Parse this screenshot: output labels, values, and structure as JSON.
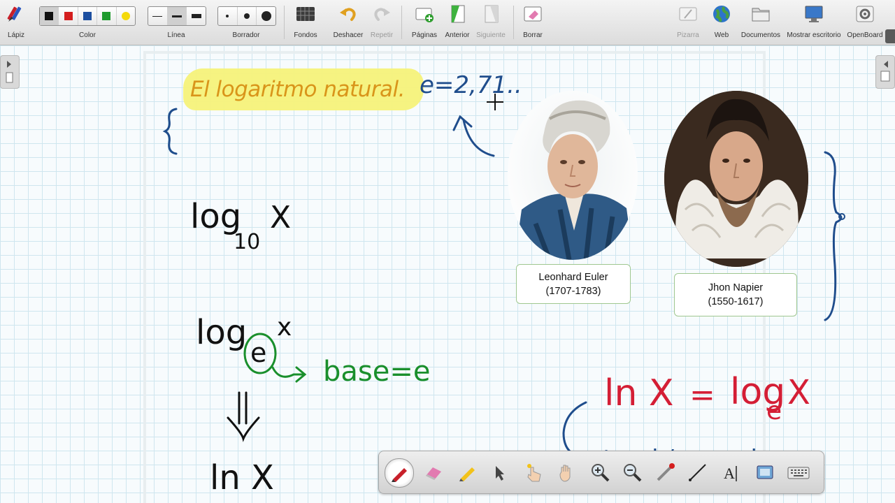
{
  "toolbar": {
    "pencil_label": "Lápiz",
    "color_label": "Color",
    "colors": [
      "#111111",
      "#d41e1e",
      "#1d4fa0",
      "#1f9a2e",
      "#f4d90a"
    ],
    "line_label": "Línea",
    "eraser_label": "Borrador",
    "backgrounds_label": "Fondos",
    "undo_label": "Deshacer",
    "redo_label": "Repetir",
    "pages_label": "Páginas",
    "previous_label": "Anterior",
    "next_label": "Siguiente",
    "clear_label": "Borrar",
    "board_label": "Pizarra",
    "web_label": "Web",
    "documents_label": "Documentos",
    "desktop_label": "Mostrar escritorio",
    "openboard_label": "OpenBoard"
  },
  "board": {
    "title": "El logaritmo natural.",
    "e_value": "e=2,71..",
    "log10": "log",
    "log10_base": "10",
    "log10_arg": "X",
    "loge": "log",
    "loge_base": "e",
    "loge_arg": "x",
    "base_note": "base=e",
    "equals_sign": "||",
    "ln_bottom": "ln X",
    "ln_eq_left": "ln X",
    "ln_eq_mid": "=",
    "ln_eq_right_log": "log",
    "ln_eq_right_base": "e",
    "ln_eq_right_arg": "X",
    "natural_note": "natural / neperiano"
  },
  "portraits": {
    "euler_name": "Leonhard Euler",
    "euler_years": "(1707-1783)",
    "napier_name": "Jhon Napier",
    "napier_years": "(1550-1617)"
  },
  "colors": {
    "ink_blue": "#1f4d8c",
    "ink_black": "#111111",
    "ink_green": "#1a8f2c",
    "ink_red": "#d41e35",
    "title_orange": "#d9951a",
    "highlight_yellow": "#f5f27a"
  },
  "float_tools": [
    "pen-icon",
    "eraser-icon",
    "highlighter-icon",
    "selector-icon",
    "interact-icon",
    "hand-icon",
    "zoom-in-icon",
    "zoom-out-icon",
    "laser-icon",
    "line-icon",
    "text-icon",
    "capture-icon",
    "keyboard-icon"
  ]
}
